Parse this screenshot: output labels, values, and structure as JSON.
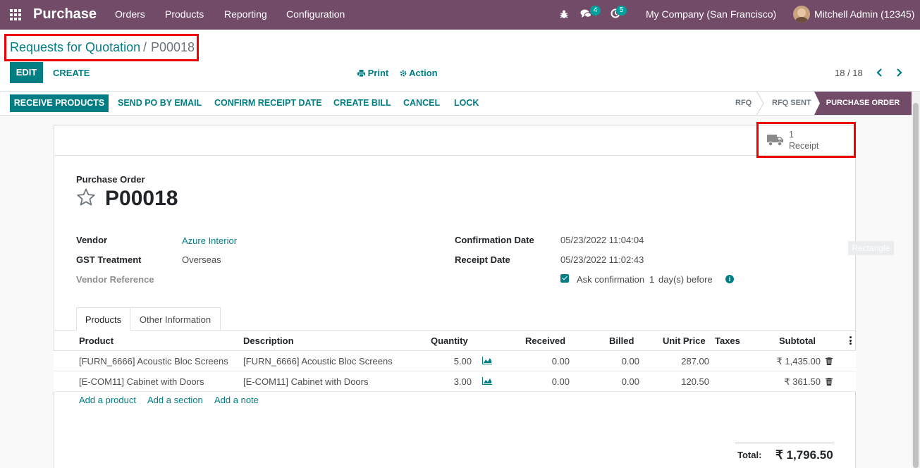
{
  "navbar": {
    "app_name": "Purchase",
    "menus": [
      "Orders",
      "Products",
      "Reporting",
      "Configuration"
    ],
    "messages_count": "4",
    "activities_count": "5",
    "company": "My Company (San Francisco)",
    "user": "Mitchell Admin (12345)"
  },
  "breadcrumb": {
    "parent": "Requests for Quotation",
    "separator": "/",
    "current": "P00018"
  },
  "control": {
    "edit_label": "EDIT",
    "create_label": "CREATE",
    "print_label": "Print",
    "action_label": "Action",
    "pager": "18 / 18"
  },
  "statusbar": {
    "buttons": [
      "RECEIVE PRODUCTS",
      "SEND PO BY EMAIL",
      "CONFIRM RECEIPT DATE",
      "CREATE BILL",
      "CANCEL",
      "LOCK"
    ],
    "stages": [
      "RFQ",
      "RFQ SENT",
      "PURCHASE ORDER"
    ],
    "active_stage": "PURCHASE ORDER"
  },
  "smart_button": {
    "count": "1",
    "label": "Receipt"
  },
  "form": {
    "doc_type": "Purchase Order",
    "name": "P00018",
    "vendor_label": "Vendor",
    "vendor": "Azure Interior",
    "gst_label": "GST Treatment",
    "gst": "Overseas",
    "vendor_ref_label": "Vendor Reference",
    "confirmation_label": "Confirmation Date",
    "confirmation_date": "05/23/2022 11:04:04",
    "receipt_label": "Receipt Date",
    "receipt_date": "05/23/2022 11:02:43",
    "ask_prefix": "Ask confirmation",
    "ask_days": "1",
    "ask_suffix": "day(s) before",
    "ghost_tip": "Rectangle"
  },
  "tabs": [
    "Products",
    "Other Information"
  ],
  "table": {
    "headers": [
      "Product",
      "Description",
      "Quantity",
      "Received",
      "Billed",
      "Unit Price",
      "Taxes",
      "Subtotal"
    ],
    "rows": [
      {
        "product": "[FURN_6666] Acoustic Bloc Screens",
        "description": "[FURN_6666] Acoustic Bloc Screens",
        "quantity": "5.00",
        "received": "0.00",
        "billed": "0.00",
        "unit_price": "287.00",
        "taxes": "",
        "subtotal": "₹ 1,435.00"
      },
      {
        "product": "[E-COM11] Cabinet with Doors",
        "description": "[E-COM11] Cabinet with Doors",
        "quantity": "3.00",
        "received": "0.00",
        "billed": "0.00",
        "unit_price": "120.50",
        "taxes": "",
        "subtotal": "₹ 361.50"
      }
    ],
    "add_links": [
      "Add a product",
      "Add a section",
      "Add a note"
    ]
  },
  "totals": {
    "label": "Total:",
    "value": "₹ 1,796.50"
  },
  "colors": {
    "brand": "#714b67",
    "accent": "#017e84",
    "highlight": "#ee0000"
  }
}
